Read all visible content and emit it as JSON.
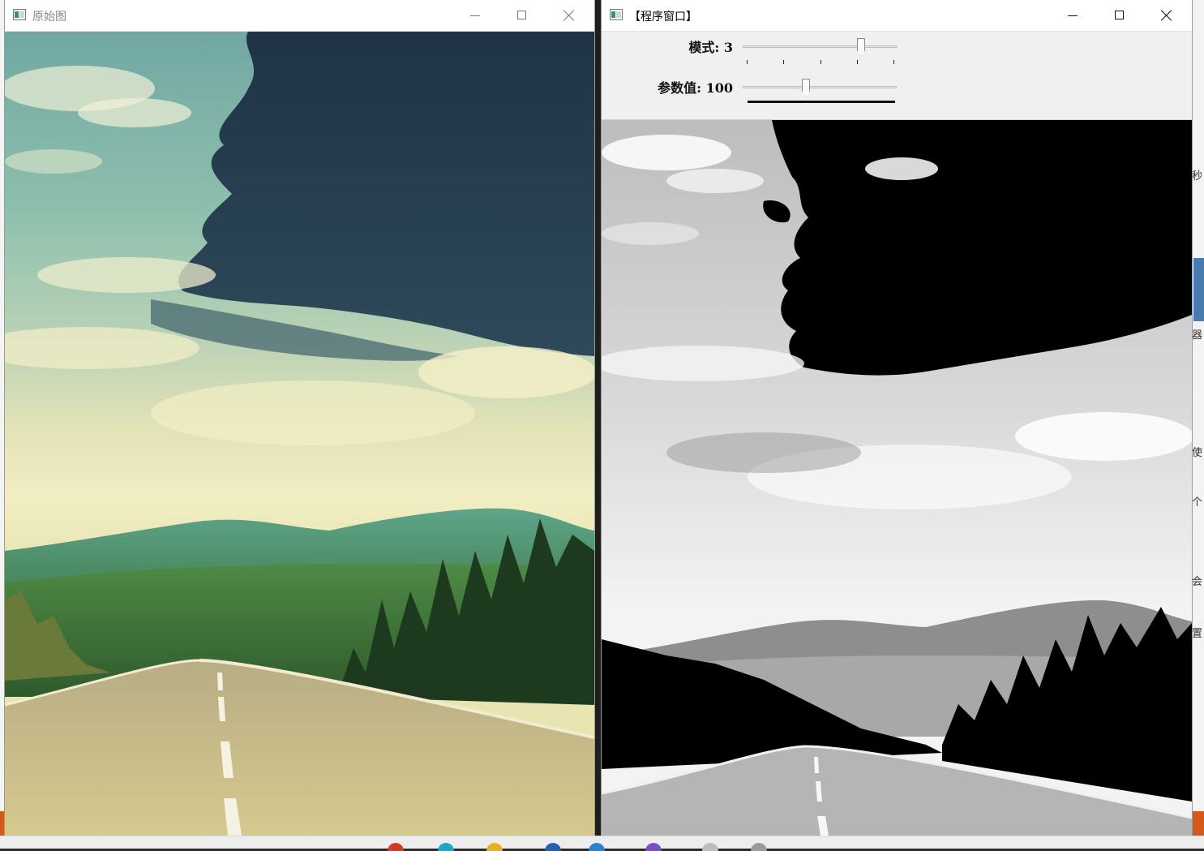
{
  "left_window": {
    "title": "原始图",
    "controls": [
      "minimize",
      "maximize",
      "close"
    ]
  },
  "right_window": {
    "title": "【程序窗口】",
    "controls": [
      "minimize",
      "maximize",
      "close"
    ],
    "trackbars": [
      {
        "label": "模式: 3",
        "value": 3,
        "max": 4
      },
      {
        "label": "参数值: 100",
        "value": 100,
        "max": 255
      }
    ]
  },
  "right_edge_glyphs": [
    "秒",
    "器",
    "使",
    "个",
    "会",
    "置"
  ],
  "colors": {
    "accent_blue": "#4a7bb0",
    "taskbar_orange": "#d45a1c"
  }
}
